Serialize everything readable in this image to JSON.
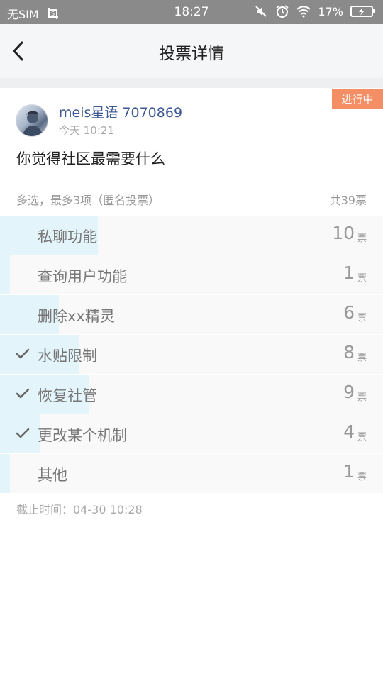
{
  "status_bar": {
    "carrier": "无SIM",
    "time": "18:27",
    "battery": "17%",
    "icons": [
      "screenshot-icon",
      "mute-icon",
      "alarm-icon",
      "wifi-icon",
      "battery-icon"
    ]
  },
  "nav": {
    "title": "投票详情",
    "back_icon": "chevron-left-icon"
  },
  "post": {
    "badge": "进行中",
    "username": "meis星语 7070869",
    "time": "今天 10:21",
    "question": "你觉得社区最需要什么",
    "meta": "多选，最多3项（匿名投票）",
    "total": "共39票"
  },
  "options": [
    {
      "label": "私聊功能",
      "count": "10",
      "unit": "票",
      "checked": false,
      "share": 0.256
    },
    {
      "label": "查询用户功能",
      "count": "1",
      "unit": "票",
      "checked": false,
      "share": 0.026
    },
    {
      "label": "删除xx精灵",
      "count": "6",
      "unit": "票",
      "checked": false,
      "share": 0.154
    },
    {
      "label": "水贴限制",
      "count": "8",
      "unit": "票",
      "checked": true,
      "share": 0.205
    },
    {
      "label": "恢复社管",
      "count": "9",
      "unit": "票",
      "checked": true,
      "share": 0.231
    },
    {
      "label": "更改某个机制",
      "count": "4",
      "unit": "票",
      "checked": true,
      "share": 0.103
    },
    {
      "label": "其他",
      "count": "1",
      "unit": "票",
      "checked": false,
      "share": 0.026
    }
  ],
  "deadline": "截止时间：04-30 10:28",
  "colors": {
    "accent_blue": "#3e5a94",
    "badge_orange": "#f48f65",
    "bar_fill": "#e3f4fb",
    "status_bar": "#8a8a8a"
  }
}
